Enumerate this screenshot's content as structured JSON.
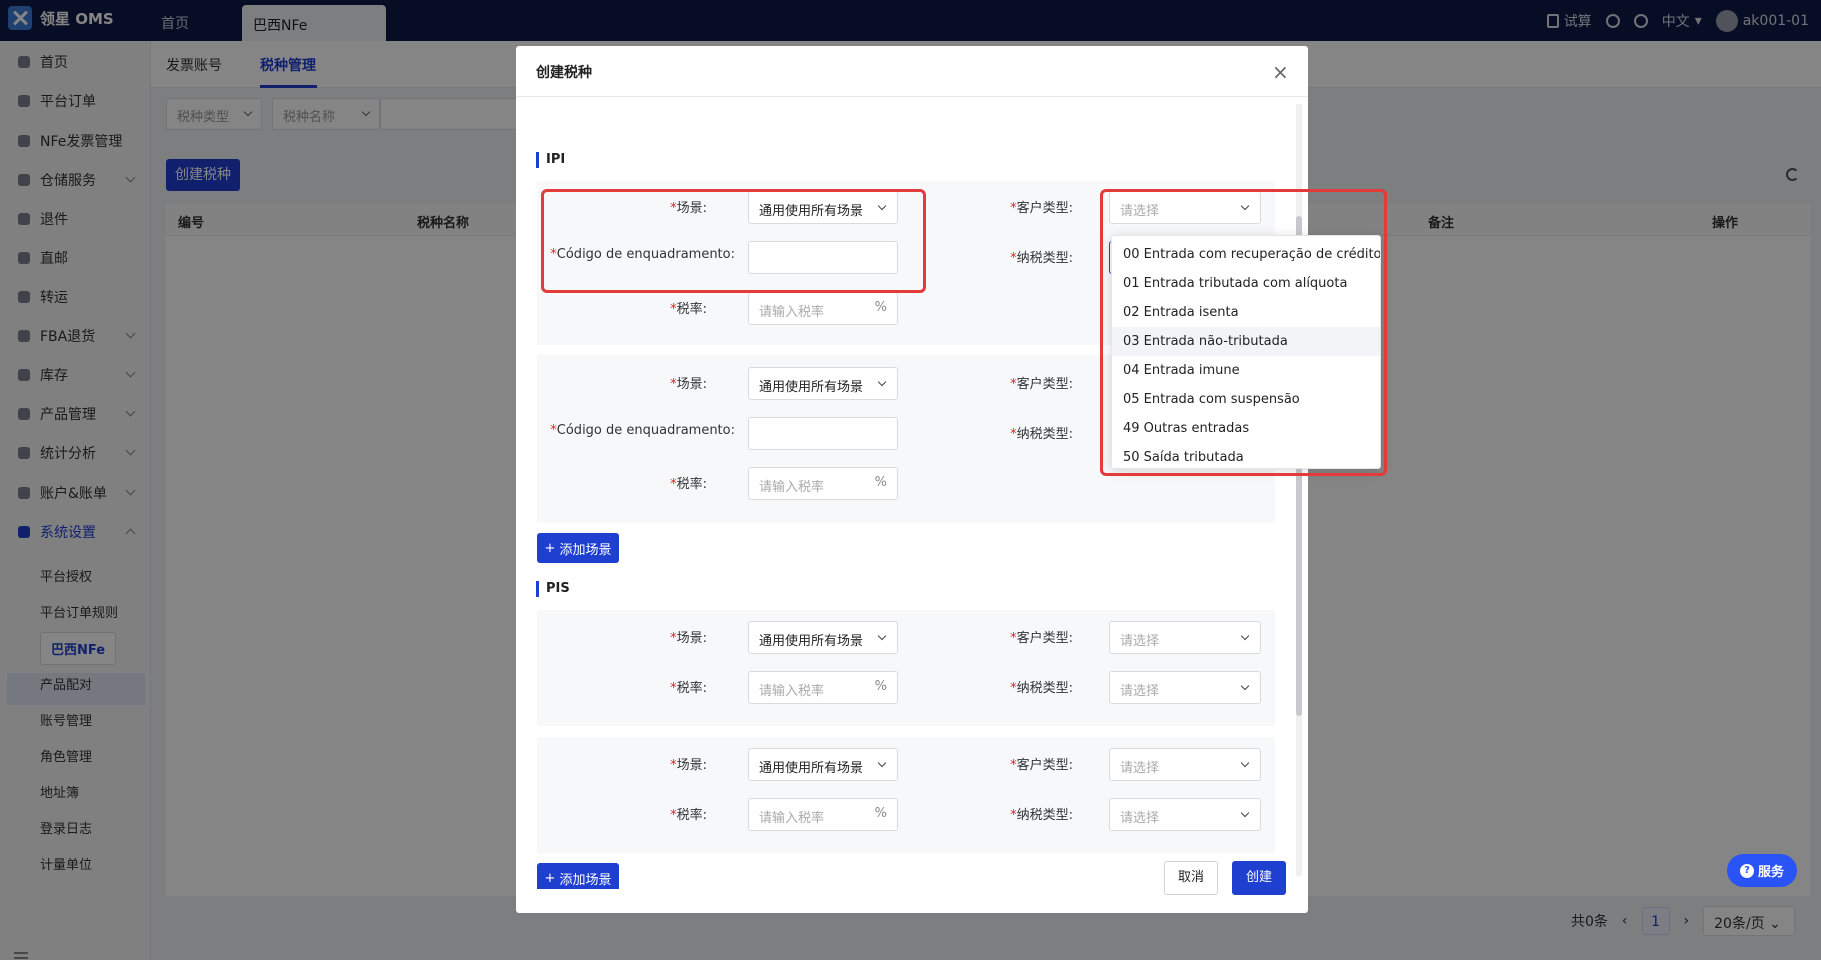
{
  "app": {
    "logo_text": "领星 OMS"
  },
  "topbar": {
    "tabs": [
      {
        "label": "首页"
      },
      {
        "label": "巴西NFe"
      }
    ],
    "actions": [
      {
        "label": "试算"
      },
      {
        "label": "中文"
      },
      {
        "label": "ak001-01"
      }
    ]
  },
  "sidebar": {
    "items": [
      {
        "label": "首页",
        "icon": "home-icon"
      },
      {
        "label": "平台订单",
        "icon": "order-icon"
      },
      {
        "label": "NFe发票管理",
        "icon": "invoice-icon"
      },
      {
        "label": "仓储服务",
        "icon": "warehouse-icon"
      },
      {
        "label": "退件",
        "icon": "return-icon"
      },
      {
        "label": "直邮",
        "icon": "mail-icon"
      },
      {
        "label": "转运",
        "icon": "transfer-icon"
      },
      {
        "label": "FBA退货",
        "icon": "fba-icon"
      },
      {
        "label": "库存",
        "icon": "inventory-icon"
      },
      {
        "label": "产品管理",
        "icon": "product-icon"
      },
      {
        "label": "统计分析",
        "icon": "stats-icon"
      },
      {
        "label": "账户&账单",
        "icon": "account-icon"
      },
      {
        "label": "系统设置",
        "icon": "settings-icon"
      }
    ],
    "sub_items": [
      {
        "label": "平台授权"
      },
      {
        "label": "平台订单规则"
      },
      {
        "label": "巴西NFe"
      },
      {
        "label": "产品配对"
      },
      {
        "label": "账号管理"
      },
      {
        "label": "角色管理"
      },
      {
        "label": "地址簿"
      },
      {
        "label": "登录日志"
      },
      {
        "label": "计量单位"
      }
    ]
  },
  "page": {
    "subtabs": [
      {
        "label": "发票账号"
      },
      {
        "label": "税种管理"
      }
    ],
    "filters": [
      {
        "placeholder": "税种类型"
      },
      {
        "placeholder": "税种名称"
      }
    ],
    "create_button": "创建税种",
    "table_columns": [
      "编号",
      "税种名称",
      "备注",
      "操作"
    ],
    "pager": {
      "total": "共0条",
      "page": "1",
      "page_size": "20条/页"
    }
  },
  "service_button": "服务",
  "modal": {
    "title": "创建税种",
    "sections": [
      {
        "title": "IPI"
      },
      {
        "title": "PIS"
      }
    ],
    "labels": {
      "scene": "场景:",
      "customer_type": "客户类型:",
      "code": "Código de enquadramento:",
      "tax_rate": "税率:",
      "taxpayer_type": "纳税类型:"
    },
    "scene_value": "通用使用所有场景",
    "select_placeholder": "请选择",
    "rate_placeholder": "请输入税率",
    "percent": "%",
    "add_scene": "添加场景",
    "cancel": "取消",
    "create": "创建"
  },
  "dropdown": {
    "options": [
      "00 Entrada com recuperação de crédito",
      "01 Entrada tributada com alíquota",
      "02 Entrada isenta",
      "03 Entrada não-tributada",
      "04 Entrada imune",
      "05 Entrada com suspensão",
      "49 Outras entradas",
      "50 Saída tributada"
    ],
    "hovered_index": 3
  },
  "colors": {
    "primary": "#1f3fd1",
    "topbar": "#0c1a45",
    "highlight": "#e33a3a"
  }
}
